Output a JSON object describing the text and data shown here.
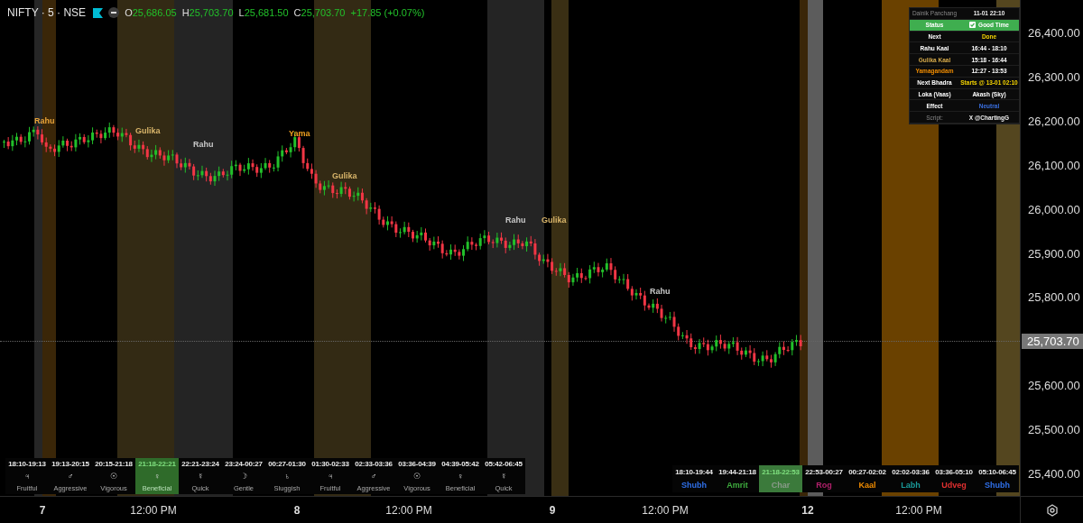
{
  "header": {
    "symbol": "NIFTY · 5 · NSE",
    "ohlc": [
      {
        "key": "O",
        "value": "25,686.05"
      },
      {
        "key": "H",
        "value": "25,703.70"
      },
      {
        "key": "L",
        "value": "25,681.50"
      },
      {
        "key": "C",
        "value": "25,703.70"
      }
    ],
    "change": "+17.85 (+0.07%)"
  },
  "chart_labels": [
    {
      "text": "Rahu",
      "color": "#e8a33a"
    },
    {
      "text": "Gulika",
      "color": "#d9b56a"
    },
    {
      "text": "Rahu",
      "color": "#c8c8c8"
    },
    {
      "text": "Yama",
      "color": "#f0a020"
    },
    {
      "text": "Gulika",
      "color": "#d9b56a"
    },
    {
      "text": "Rahu",
      "color": "#c8c8c8"
    },
    {
      "text": "Gulika",
      "color": "#d9b56a"
    },
    {
      "text": "Rahu",
      "color": "#c8c8c8"
    }
  ],
  "panchang": [
    {
      "label": "Dainik Panchang",
      "value": "11-01 22:10",
      "kind": "title"
    },
    {
      "label": "Status",
      "value": "Good Time",
      "kind": "badge"
    },
    {
      "label": "Next",
      "value": "Done",
      "kind": "highlight"
    },
    {
      "label": "Rahu Kaal",
      "value": "16:44 - 18:10",
      "kind": "plain"
    },
    {
      "label": "Gulika Kaal",
      "value": "15:18 - 16:44",
      "kind": "gulika"
    },
    {
      "label": "Yamagandam",
      "value": "12:27 - 13:53",
      "kind": "yama"
    },
    {
      "label": "Next Bhadra",
      "value": "Starts @ 13-01 02:10",
      "kind": "highlight"
    },
    {
      "label": "Loka (Vaas)",
      "value": "Akash (Sky)",
      "kind": "plain"
    },
    {
      "label": "Effect",
      "value": "Neutral",
      "kind": "info"
    },
    {
      "label": "Script:",
      "value": "X @ChartingG",
      "kind": "footer"
    }
  ],
  "hora": [
    {
      "time": "18:10-19:13",
      "symbol": "♃",
      "quality": "Fruitful",
      "selected": false
    },
    {
      "time": "19:13-20:15",
      "symbol": "♂",
      "quality": "Aggressive",
      "selected": false
    },
    {
      "time": "20:15-21:18",
      "symbol": "☉",
      "quality": "Vigorous",
      "selected": false
    },
    {
      "time": "21:18-22:21",
      "symbol": "♀",
      "quality": "Beneficial",
      "selected": true
    },
    {
      "time": "22:21-23:24",
      "symbol": "☿",
      "quality": "Quick",
      "selected": false
    },
    {
      "time": "23:24-00:27",
      "symbol": "☽",
      "quality": "Gentle",
      "selected": false
    },
    {
      "time": "00:27-01:30",
      "symbol": "♄",
      "quality": "Sluggish",
      "selected": false
    },
    {
      "time": "01:30-02:33",
      "symbol": "♃",
      "quality": "Fruitful",
      "selected": false
    },
    {
      "time": "02:33-03:36",
      "symbol": "♂",
      "quality": "Aggressive",
      "selected": false
    },
    {
      "time": "03:36-04:39",
      "symbol": "☉",
      "quality": "Vigorous",
      "selected": false
    },
    {
      "time": "04:39-05:42",
      "symbol": "♀",
      "quality": "Beneficial",
      "selected": false
    },
    {
      "time": "05:42-06:45",
      "symbol": "☿",
      "quality": "Quick",
      "selected": false
    }
  ],
  "choghadiya": [
    {
      "time": "18:10-19:44",
      "name": "Shubh",
      "color": "#2f6fe8",
      "selected": false
    },
    {
      "time": "19:44-21:18",
      "name": "Amrit",
      "color": "#3fae3f",
      "selected": false
    },
    {
      "time": "21:18-22:53",
      "name": "Char",
      "color": "#8a9a8a",
      "selected": true
    },
    {
      "time": "22:53-00:27",
      "name": "Rog",
      "color": "#b0206a",
      "selected": false
    },
    {
      "time": "00:27-02:02",
      "name": "Kaal",
      "color": "#f08c00",
      "selected": false
    },
    {
      "time": "02:02-03:36",
      "name": "Labh",
      "color": "#1a9a9a",
      "selected": false
    },
    {
      "time": "03:36-05:10",
      "name": "Udveg",
      "color": "#e03030",
      "selected": false
    },
    {
      "time": "05:10-06:45",
      "name": "Shubh",
      "color": "#2f6fe8",
      "selected": false
    }
  ],
  "price_axis": {
    "ticks": [
      "26,400.00",
      "26,300.00",
      "26,200.00",
      "26,100.00",
      "26,000.00",
      "25,900.00",
      "25,800.00",
      "25,600.00",
      "25,500.00",
      "25,400.00"
    ],
    "last_price": "25,703.70"
  },
  "time_axis": [
    {
      "label": "7",
      "kind": "day"
    },
    {
      "label": "12:00 PM",
      "kind": "time"
    },
    {
      "label": "8",
      "kind": "day"
    },
    {
      "label": "12:00 PM",
      "kind": "time"
    },
    {
      "label": "9",
      "kind": "day"
    },
    {
      "label": "12:00 PM",
      "kind": "time"
    },
    {
      "label": "12",
      "kind": "day"
    },
    {
      "label": "12:00 PM",
      "kind": "time"
    }
  ]
}
